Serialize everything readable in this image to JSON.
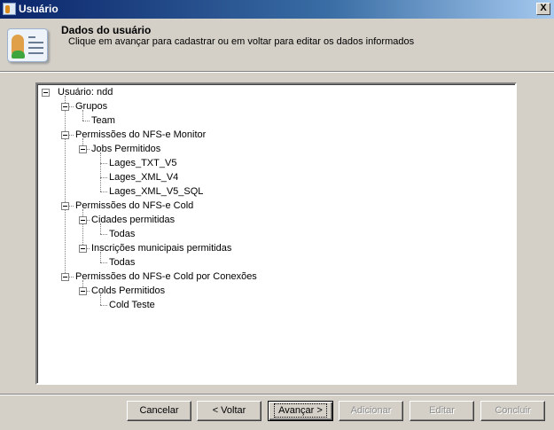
{
  "window": {
    "title": "Usuário",
    "close_label": "X"
  },
  "header": {
    "title": "Dados do usuário",
    "subtitle": "Clique em avançar para cadastrar ou em voltar para editar os dados informados"
  },
  "tree": [
    {
      "label": "Usuário: ndd",
      "level": 0,
      "expandable": true
    },
    {
      "label": "Grupos",
      "level": 1,
      "expandable": true
    },
    {
      "label": "Team",
      "level": 2,
      "expandable": false
    },
    {
      "label": "Permissões do NFS-e Monitor",
      "level": 1,
      "expandable": true
    },
    {
      "label": "Jobs Permitidos",
      "level": 2,
      "expandable": true
    },
    {
      "label": "Lages_TXT_V5",
      "level": 3,
      "expandable": false
    },
    {
      "label": "Lages_XML_V4",
      "level": 3,
      "expandable": false
    },
    {
      "label": "Lages_XML_V5_SQL",
      "level": 3,
      "expandable": false
    },
    {
      "label": "Permissões do NFS-e Cold",
      "level": 1,
      "expandable": true
    },
    {
      "label": "Cidades permitidas",
      "level": 2,
      "expandable": true
    },
    {
      "label": "Todas",
      "level": 3,
      "expandable": false
    },
    {
      "label": "Inscrições municipais permitidas",
      "level": 2,
      "expandable": true
    },
    {
      "label": "Todas",
      "level": 3,
      "expandable": false
    },
    {
      "label": "Permissões do NFS-e Cold por Conexões",
      "level": 1,
      "expandable": true
    },
    {
      "label": "Colds Permitidos",
      "level": 2,
      "expandable": true
    },
    {
      "label": "Cold Teste",
      "level": 3,
      "expandable": false
    }
  ],
  "buttons": {
    "cancel": "Cancelar",
    "back": "< Voltar",
    "next": "Avançar >",
    "add": "Adicionar",
    "edit": "Editar",
    "finish": "Concluir"
  }
}
